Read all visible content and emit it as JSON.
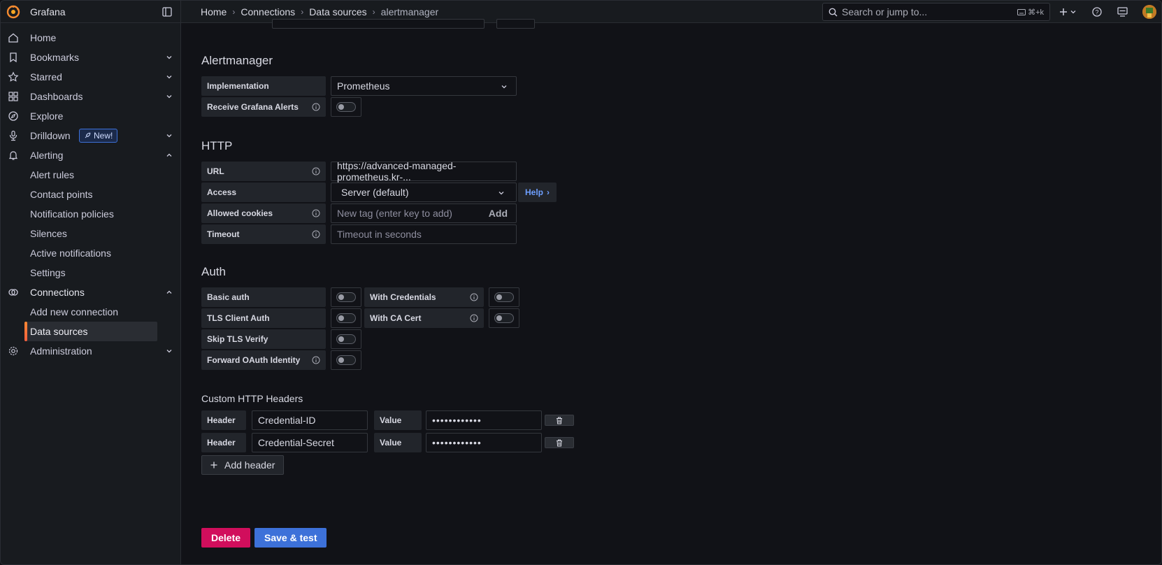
{
  "app": {
    "name": "Grafana"
  },
  "breadcrumb": [
    "Home",
    "Connections",
    "Data sources",
    "alertmanager"
  ],
  "search": {
    "placeholder": "Search or jump to...",
    "shortcut": "⌘+k"
  },
  "sidebar": {
    "items": [
      {
        "label": "Home",
        "icon": "home-icon"
      },
      {
        "label": "Bookmarks",
        "icon": "bookmark-icon",
        "chevron": "down"
      },
      {
        "label": "Starred",
        "icon": "star-icon",
        "chevron": "down"
      },
      {
        "label": "Dashboards",
        "icon": "dashboards-icon",
        "chevron": "down"
      },
      {
        "label": "Explore",
        "icon": "compass-icon"
      },
      {
        "label": "Drilldown",
        "icon": "drilldown-icon",
        "chevron": "down",
        "badge": "New!"
      },
      {
        "label": "Alerting",
        "icon": "bell-icon",
        "chevron": "up"
      },
      {
        "label": "Alert rules"
      },
      {
        "label": "Contact points"
      },
      {
        "label": "Notification policies"
      },
      {
        "label": "Silences"
      },
      {
        "label": "Active notifications"
      },
      {
        "label": "Settings"
      },
      {
        "label": "Connections",
        "icon": "connections-icon",
        "chevron": "up"
      },
      {
        "label": "Add new connection"
      },
      {
        "label": "Data sources",
        "active": true
      },
      {
        "label": "Administration",
        "icon": "gear-icon",
        "chevron": "down"
      }
    ]
  },
  "alertmanager": {
    "title": "Alertmanager",
    "implementation_label": "Implementation",
    "implementation_value": "Prometheus",
    "receive_label": "Receive Grafana Alerts"
  },
  "http": {
    "title": "HTTP",
    "url_label": "URL",
    "url_value": "https://advanced-managed-prometheus.kr-...",
    "access_label": "Access",
    "access_value": "Server (default)",
    "help_label": "Help",
    "cookies_label": "Allowed cookies",
    "cookies_placeholder": "New tag (enter key to add)",
    "cookies_add": "Add",
    "timeout_label": "Timeout",
    "timeout_placeholder": "Timeout in seconds"
  },
  "auth": {
    "title": "Auth",
    "basic_auth": "Basic auth",
    "with_credentials": "With Credentials",
    "tls_client_auth": "TLS Client Auth",
    "with_ca_cert": "With CA Cert",
    "skip_tls": "Skip TLS Verify",
    "forward_oauth": "Forward OAuth Identity"
  },
  "headers": {
    "title": "Custom HTTP Headers",
    "header_label": "Header",
    "value_label": "Value",
    "rows": [
      {
        "header": "Credential-ID",
        "value": "••••••••••••"
      },
      {
        "header": "Credential-Secret",
        "value": "••••••••••••"
      }
    ],
    "add_label": "Add header"
  },
  "actions": {
    "delete": "Delete",
    "save": "Save & test"
  },
  "colors": {
    "accent": "#3d71d9",
    "danger": "#d10e5c",
    "active": "#f55f3e"
  }
}
